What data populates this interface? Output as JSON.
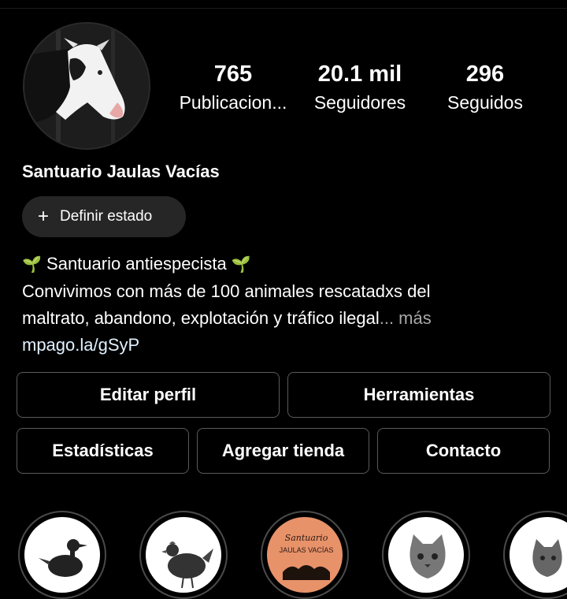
{
  "profile": {
    "name": "Santuario Jaulas Vacías",
    "avatar_alt": "cow-photo"
  },
  "stats": [
    {
      "value": "765",
      "label": "Publicacion..."
    },
    {
      "value": "20.1 mil",
      "label": "Seguidores"
    },
    {
      "value": "296",
      "label": "Seguidos"
    }
  ],
  "status_button": {
    "label": "Definir estado",
    "icon": "plus-icon"
  },
  "bio": {
    "line1": "Santuario antiespecista",
    "line2": "Convivimos con más de 100 animales rescatadxs del",
    "line3": "maltrato, abandono, explotación y tráfico ilegal",
    "more": "... más",
    "link": "mpago.la/gSyP",
    "emoji": "🌱"
  },
  "buttons": {
    "edit_profile": "Editar perfil",
    "tools": "Herramientas",
    "stats": "Estadísticas",
    "add_store": "Agregar tienda",
    "contact": "Contacto"
  },
  "highlights": [
    {
      "icon": "duck-icon"
    },
    {
      "icon": "hen-icon"
    },
    {
      "icon": "sanctuary-logo-icon",
      "text_top": "Santuario",
      "text_bottom": "JAULAS VACÍAS",
      "color": "#e8926a"
    },
    {
      "icon": "cat-icon"
    },
    {
      "icon": "cat-dog-icon"
    }
  ],
  "colors": {
    "background": "#000000",
    "button_border": "#5a5a5a",
    "status_bg": "#262626",
    "link": "#e0f1ff",
    "more": "#a8a8a8"
  }
}
